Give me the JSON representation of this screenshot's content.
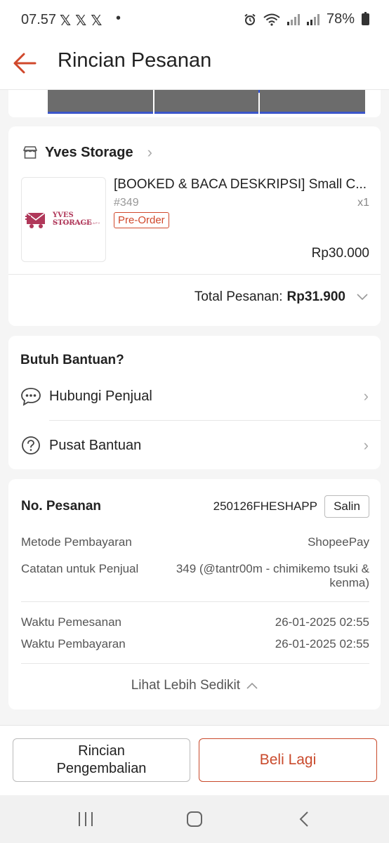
{
  "status_bar": {
    "time": "07.57",
    "social_icons": "𝕏𝕏𝕏",
    "dot": "•",
    "battery": "78%"
  },
  "header": {
    "title": "Rincian Pesanan"
  },
  "shop": {
    "name": "Yves Storage",
    "logo_text": "YVES STORAGE",
    "logo_subtext": "SHIPPING IS A THERAPY",
    "product": {
      "name": "[BOOKED & BACA DESKRIPSI] Small C...",
      "variant": "#349",
      "quantity": "x1",
      "badge": "Pre-Order",
      "price": "Rp30.000"
    },
    "total_label": "Total Pesanan:",
    "total_value": "Rp31.900"
  },
  "help": {
    "title": "Butuh Bantuan?",
    "items": [
      {
        "label": "Hubungi Penjual",
        "icon": "chat-icon"
      },
      {
        "label": "Pusat Bantuan",
        "icon": "question-icon"
      }
    ]
  },
  "order": {
    "number_label": "No. Pesanan",
    "number_value": "250126FHESHAPP",
    "copy_label": "Salin",
    "payment_label": "Metode Pembayaran",
    "payment_value": "ShopeePay",
    "note_label": "Catatan untuk Penjual",
    "note_value_line1": "349 (@tantr00m - chimikemo tsuki &",
    "note_value_line2": "kenma)",
    "order_time_label": "Waktu Pemesanan",
    "order_time_value": "26-01-2025 02:55",
    "pay_time_label": "Waktu Pembayaran",
    "pay_time_value": "26-01-2025 02:55",
    "see_less": "Lihat Lebih Sedikit"
  },
  "actions": {
    "return_line1": "Rincian",
    "return_line2": "Pengembalian",
    "buy_again": "Beli Lagi"
  },
  "colors": {
    "accent": "#d0482b",
    "background": "#f5f5f5"
  }
}
